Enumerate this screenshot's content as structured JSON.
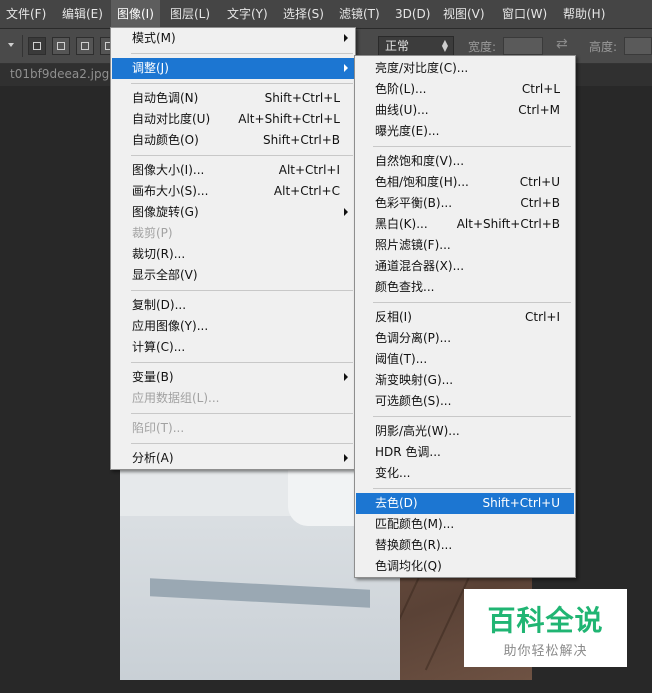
{
  "menubar": {
    "items": [
      "文件(F)",
      "编辑(E)",
      "图像(I)",
      "图层(L)",
      "文字(Y)",
      "选择(S)",
      "滤镜(T)",
      "3D(D)",
      "视图(V)",
      "窗口(W)",
      "帮助(H)"
    ],
    "active_index": 2
  },
  "options": {
    "mode_value": "正常",
    "width_label": "宽度:",
    "height_label": "高度:"
  },
  "document": {
    "tab_title": "t01bf9deea2.jpg @"
  },
  "image_menu": [
    {
      "label": "模式(M)",
      "shortcut": "",
      "submenu": true
    },
    {
      "sep": true
    },
    {
      "label": "调整(J)",
      "shortcut": "",
      "submenu": true,
      "highlighted": true
    },
    {
      "sep": true
    },
    {
      "label": "自动色调(N)",
      "shortcut": "Shift+Ctrl+L"
    },
    {
      "label": "自动对比度(U)",
      "shortcut": "Alt+Shift+Ctrl+L"
    },
    {
      "label": "自动颜色(O)",
      "shortcut": "Shift+Ctrl+B"
    },
    {
      "sep": true
    },
    {
      "label": "图像大小(I)...",
      "shortcut": "Alt+Ctrl+I"
    },
    {
      "label": "画布大小(S)...",
      "shortcut": "Alt+Ctrl+C"
    },
    {
      "label": "图像旋转(G)",
      "shortcut": "",
      "submenu": true
    },
    {
      "label": "裁剪(P)",
      "shortcut": "",
      "disabled": true
    },
    {
      "label": "裁切(R)...",
      "shortcut": ""
    },
    {
      "label": "显示全部(V)",
      "shortcut": ""
    },
    {
      "sep": true
    },
    {
      "label": "复制(D)...",
      "shortcut": ""
    },
    {
      "label": "应用图像(Y)...",
      "shortcut": ""
    },
    {
      "label": "计算(C)...",
      "shortcut": ""
    },
    {
      "sep": true
    },
    {
      "label": "变量(B)",
      "shortcut": "",
      "submenu": true
    },
    {
      "label": "应用数据组(L)...",
      "shortcut": "",
      "disabled": true
    },
    {
      "sep": true
    },
    {
      "label": "陷印(T)...",
      "shortcut": "",
      "disabled": true
    },
    {
      "sep": true
    },
    {
      "label": "分析(A)",
      "shortcut": "",
      "submenu": true
    }
  ],
  "adjust_menu": [
    {
      "label": "亮度/对比度(C)...",
      "shortcut": ""
    },
    {
      "label": "色阶(L)...",
      "shortcut": "Ctrl+L"
    },
    {
      "label": "曲线(U)...",
      "shortcut": "Ctrl+M"
    },
    {
      "label": "曝光度(E)...",
      "shortcut": ""
    },
    {
      "sep": true
    },
    {
      "label": "自然饱和度(V)...",
      "shortcut": ""
    },
    {
      "label": "色相/饱和度(H)...",
      "shortcut": "Ctrl+U"
    },
    {
      "label": "色彩平衡(B)...",
      "shortcut": "Ctrl+B"
    },
    {
      "label": "黑白(K)...",
      "shortcut": "Alt+Shift+Ctrl+B"
    },
    {
      "label": "照片滤镜(F)...",
      "shortcut": ""
    },
    {
      "label": "通道混合器(X)...",
      "shortcut": ""
    },
    {
      "label": "颜色查找...",
      "shortcut": ""
    },
    {
      "sep": true
    },
    {
      "label": "反相(I)",
      "shortcut": "Ctrl+I"
    },
    {
      "label": "色调分离(P)...",
      "shortcut": ""
    },
    {
      "label": "阈值(T)...",
      "shortcut": ""
    },
    {
      "label": "渐变映射(G)...",
      "shortcut": ""
    },
    {
      "label": "可选颜色(S)...",
      "shortcut": ""
    },
    {
      "sep": true
    },
    {
      "label": "阴影/高光(W)...",
      "shortcut": ""
    },
    {
      "label": "HDR 色调...",
      "shortcut": ""
    },
    {
      "label": "变化...",
      "shortcut": ""
    },
    {
      "sep": true
    },
    {
      "label": "去色(D)",
      "shortcut": "Shift+Ctrl+U",
      "highlighted": true
    },
    {
      "label": "匹配颜色(M)...",
      "shortcut": ""
    },
    {
      "label": "替换颜色(R)...",
      "shortcut": ""
    },
    {
      "label": "色调均化(Q)",
      "shortcut": ""
    }
  ],
  "watermark": {
    "title": "百科全说",
    "subtitle": "助你轻松解决"
  },
  "colors": {
    "highlight": "#1c76d2",
    "menu_bg": "#f0f0f0",
    "menubar_bg": "#454545",
    "watermark_green": "#20b573"
  }
}
